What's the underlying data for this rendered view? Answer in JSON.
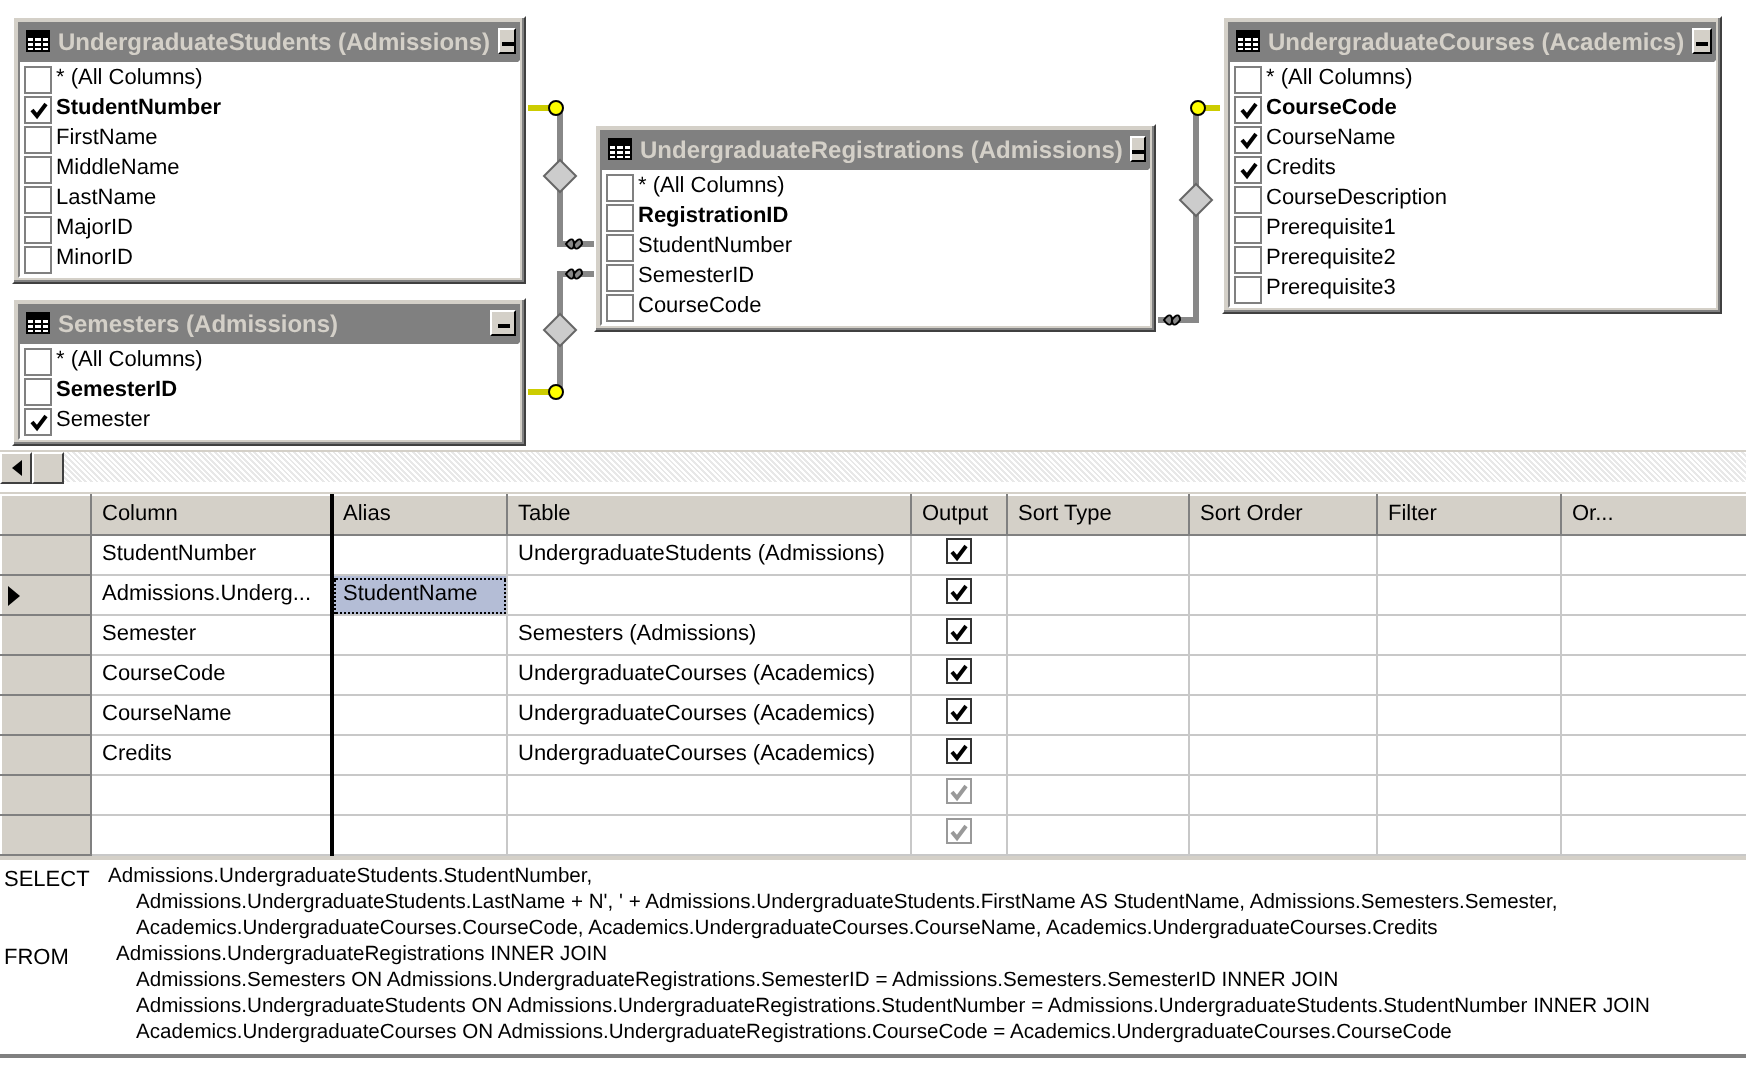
{
  "diagram": {
    "tables": [
      {
        "title": "UndergraduateStudents (Admissions)",
        "columns": [
          {
            "name": "* (All Columns)",
            "key": false,
            "checked": false
          },
          {
            "name": "StudentNumber",
            "key": true,
            "checked": true
          },
          {
            "name": "FirstName",
            "key": false,
            "checked": false
          },
          {
            "name": "MiddleName",
            "key": false,
            "checked": false
          },
          {
            "name": "LastName",
            "key": false,
            "checked": false
          },
          {
            "name": "MajorID",
            "key": false,
            "checked": false
          },
          {
            "name": "MinorID",
            "key": false,
            "checked": false
          }
        ]
      },
      {
        "title": "Semesters (Admissions)",
        "columns": [
          {
            "name": "* (All Columns)",
            "key": false,
            "checked": false
          },
          {
            "name": "SemesterID",
            "key": true,
            "checked": false
          },
          {
            "name": "Semester",
            "key": false,
            "checked": true
          }
        ]
      },
      {
        "title": "UndergraduateRegistrations (Admissions)",
        "columns": [
          {
            "name": "* (All Columns)",
            "key": false,
            "checked": false
          },
          {
            "name": "RegistrationID",
            "key": true,
            "checked": false
          },
          {
            "name": "StudentNumber",
            "key": false,
            "checked": false
          },
          {
            "name": "SemesterID",
            "key": false,
            "checked": false
          },
          {
            "name": "CourseCode",
            "key": false,
            "checked": false
          }
        ]
      },
      {
        "title": "UndergraduateCourses (Academics)",
        "columns": [
          {
            "name": "* (All Columns)",
            "key": false,
            "checked": false
          },
          {
            "name": "CourseCode",
            "key": true,
            "checked": true
          },
          {
            "name": "CourseName",
            "key": false,
            "checked": true
          },
          {
            "name": "Credits",
            "key": false,
            "checked": true
          },
          {
            "name": "CourseDescription",
            "key": false,
            "checked": false
          },
          {
            "name": "Prerequisite1",
            "key": false,
            "checked": false
          },
          {
            "name": "Prerequisite2",
            "key": false,
            "checked": false
          },
          {
            "name": "Prerequisite3",
            "key": false,
            "checked": false
          }
        ]
      }
    ]
  },
  "grid": {
    "headers": [
      "Column",
      "Alias",
      "Table",
      "Output",
      "Sort Type",
      "Sort Order",
      "Filter",
      "Or..."
    ],
    "rows": [
      {
        "selected": false,
        "column": "StudentNumber",
        "table": "UndergraduateStudents (Admissions)",
        "output": {
          "checked": true,
          "disabled": false
        }
      },
      {
        "selected": true,
        "column": "Admissions.Underg...",
        "alias": "StudentName",
        "output": {
          "checked": true,
          "disabled": false
        }
      },
      {
        "selected": false,
        "column": "Semester",
        "table": "Semesters (Admissions)",
        "output": {
          "checked": true,
          "disabled": false
        }
      },
      {
        "selected": false,
        "column": "CourseCode",
        "table": "UndergraduateCourses (Academics)",
        "output": {
          "checked": true,
          "disabled": false
        }
      },
      {
        "selected": false,
        "column": "CourseName",
        "table": "UndergraduateCourses (Academics)",
        "output": {
          "checked": true,
          "disabled": false
        }
      },
      {
        "selected": false,
        "column": "Credits",
        "table": "UndergraduateCourses (Academics)",
        "output": {
          "checked": true,
          "disabled": false
        }
      },
      {
        "selected": false,
        "output": {
          "checked": true,
          "disabled": true
        }
      },
      {
        "selected": false,
        "output": {
          "checked": true,
          "disabled": true
        }
      }
    ]
  },
  "sql": [
    {
      "clause": "SELECT",
      "lines": [
        "Admissions.UndergraduateStudents.StudentNumber,",
        "Admissions.UndergraduateStudents.LastName + N', ' + Admissions.UndergraduateStudents.FirstName AS StudentName, Admissions.Semesters.Semester,",
        "Academics.UndergraduateCourses.CourseCode, Academics.UndergraduateCourses.CourseName, Academics.UndergraduateCourses.Credits"
      ]
    },
    {
      "clause": "FROM",
      "lines": [
        "Admissions.UndergraduateRegistrations INNER JOIN",
        "Admissions.Semesters ON Admissions.UndergraduateRegistrations.SemesterID = Admissions.Semesters.SemesterID INNER JOIN",
        "Admissions.UndergraduateStudents ON Admissions.UndergraduateRegistrations.StudentNumber = Admissions.UndergraduateStudents.StudentNumber INNER JOIN",
        "Academics.UndergraduateCourses ON Admissions.UndergraduateRegistrations.CourseCode = Academics.UndergraduateCourses.CourseCode"
      ]
    }
  ]
}
